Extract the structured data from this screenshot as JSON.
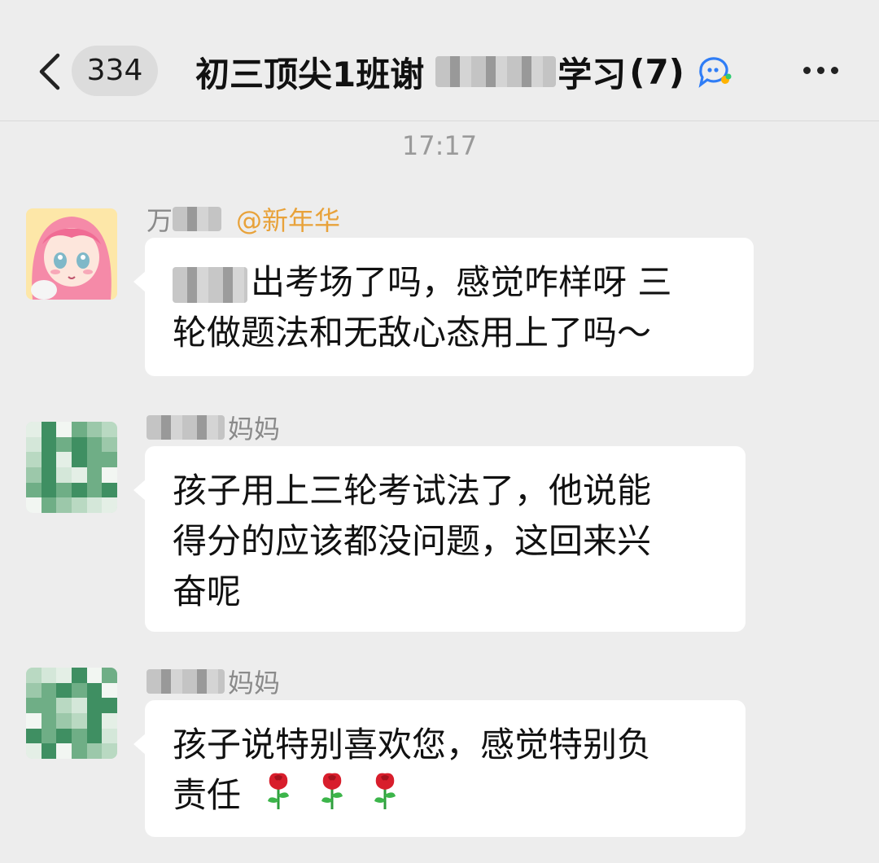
{
  "header": {
    "back_label": "",
    "unread_count": "334",
    "title_prefix": "初三顶尖1班谢",
    "title_suffix": "学习",
    "member_count": "(7)"
  },
  "time_divider": "17:17",
  "messages": [
    {
      "sender_visible": "万",
      "mention": "@新年华",
      "text_line1": "出考场了吗，感觉咋样呀 三",
      "text_line2": "轮做题法和无敌心态用上了吗～"
    },
    {
      "sender_visible": "妈妈",
      "text_line1": "孩子用上三轮考试法了，他说能",
      "text_line2": "得分的应该都没问题，这回来兴",
      "text_line3": "奋呢"
    },
    {
      "sender_visible": "妈妈",
      "text_line1": "孩子说特别喜欢您，感觉特别负",
      "text_line2": "责任",
      "emoji": [
        "rose-emoji",
        "rose-emoji",
        "rose-emoji"
      ]
    }
  ],
  "colors": {
    "background": "#ededed",
    "bubble": "#ffffff",
    "mention": "#e8a23a",
    "meta_text": "#8a8a8a"
  }
}
